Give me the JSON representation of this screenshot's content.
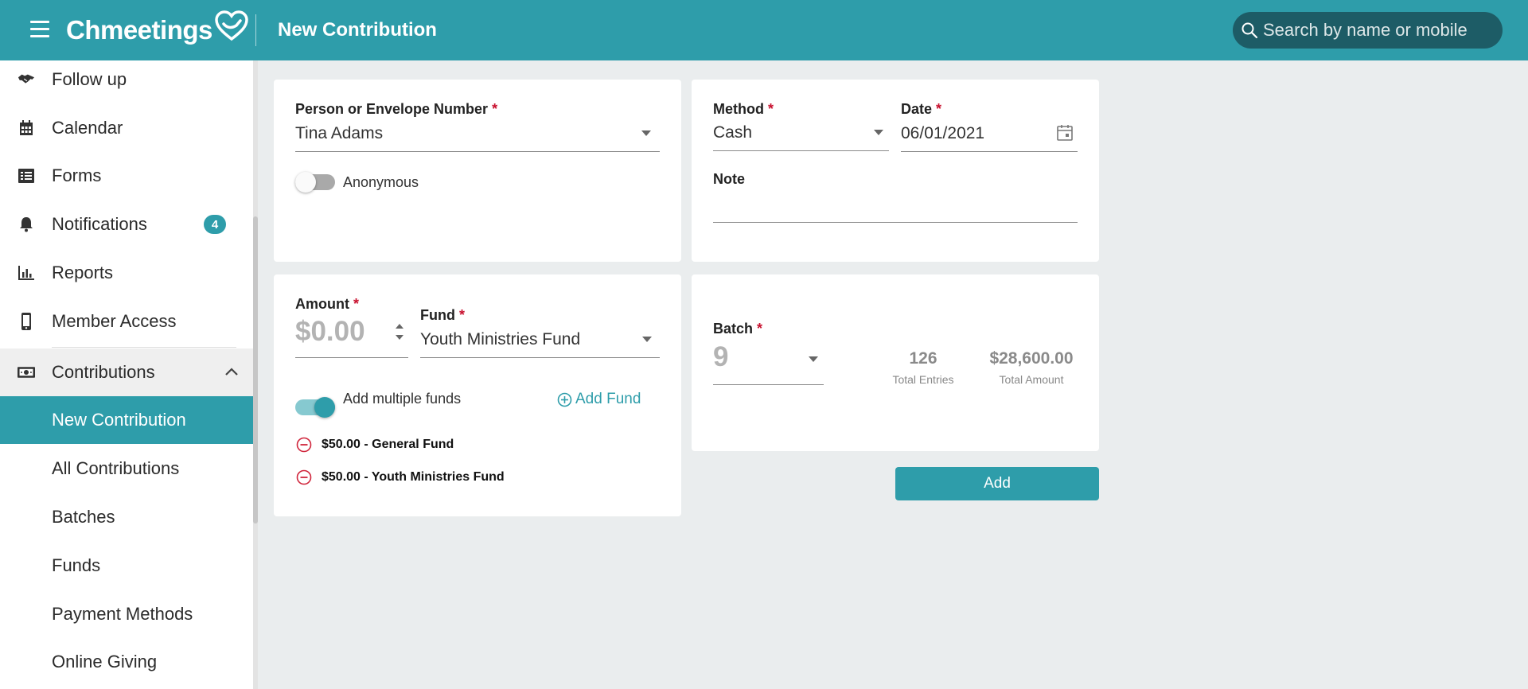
{
  "header": {
    "logo_text": "Chmeetings",
    "page_title": "New Contribution",
    "search_placeholder": "Search by name or mobile"
  },
  "sidebar": {
    "items": [
      {
        "label": "Follow up",
        "icon": "handshake-icon"
      },
      {
        "label": "Calendar",
        "icon": "calendar-icon"
      },
      {
        "label": "Forms",
        "icon": "list-icon"
      },
      {
        "label": "Notifications",
        "icon": "bell-icon",
        "badge": "4"
      },
      {
        "label": "Reports",
        "icon": "bar-chart-icon"
      },
      {
        "label": "Member Access",
        "icon": "mobile-phone-icon"
      },
      {
        "label": "Contributions",
        "icon": "money-icon"
      }
    ],
    "sub_items": [
      {
        "label": "New Contribution"
      },
      {
        "label": "All Contributions"
      },
      {
        "label": "Batches"
      },
      {
        "label": "Funds"
      },
      {
        "label": "Payment Methods"
      },
      {
        "label": "Online Giving"
      }
    ]
  },
  "person_card": {
    "label": "Person or Envelope Number",
    "required": "*",
    "value": "Tina Adams",
    "anonymous_label": "Anonymous"
  },
  "method_card": {
    "method_label": "Method",
    "method_value": "Cash",
    "date_label": "Date",
    "date_value": "06/01/2021",
    "note_label": "Note",
    "note_value": "",
    "required": "*"
  },
  "amount_card": {
    "amount_label": "Amount",
    "amount_value": "$0.00",
    "fund_label": "Fund",
    "fund_value": "Youth Ministries Fund",
    "multiple_label": "Add multiple funds",
    "add_fund_label": "Add Fund",
    "funds": [
      {
        "text": "$50.00 - General Fund"
      },
      {
        "text": "$50.00 - Youth Ministries Fund"
      }
    ],
    "required": "*"
  },
  "batch_card": {
    "batch_label": "Batch",
    "batch_value": "9",
    "entries_value": "126",
    "entries_label": "Total Entries",
    "amount_value": "$28,600.00",
    "amount_label": "Total Amount",
    "required": "*"
  },
  "actions": {
    "add_label": "Add"
  },
  "colors": {
    "brand": "#2e9daa",
    "search_bg": "#1d5c66",
    "required": "#c8102e",
    "background": "#eaedee"
  }
}
